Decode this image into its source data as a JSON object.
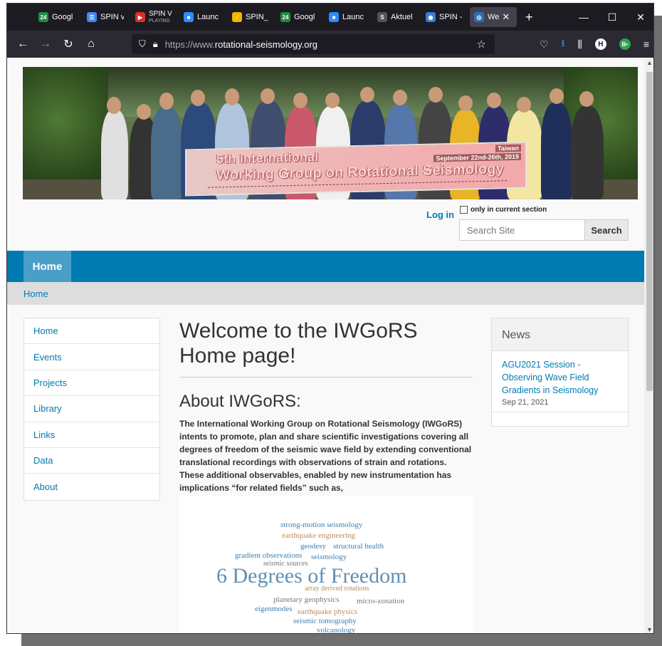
{
  "browser": {
    "tabs": [
      {
        "label": "Googl",
        "fav_color": "#1e8e3e",
        "fav_text": "24"
      },
      {
        "label": "SPIN v",
        "fav_color": "#4285f4",
        "fav_text": "☰"
      },
      {
        "label": "SPIN V",
        "sublabel": "PLAYING",
        "fav_color": "#d93025",
        "fav_text": "▶"
      },
      {
        "label": "Launc",
        "fav_color": "#2d8cff",
        "fav_text": "■"
      },
      {
        "label": "SPIN_",
        "fav_color": "#f4b400",
        "fav_text": "⚡"
      },
      {
        "label": "Googl",
        "fav_color": "#1e8e3e",
        "fav_text": "24"
      },
      {
        "label": "Launc",
        "fav_color": "#2d8cff",
        "fav_text": "■"
      },
      {
        "label": "Aktuel",
        "fav_color": "#555",
        "fav_text": "S"
      },
      {
        "label": "SPIN -",
        "fav_color": "#3a7bd5",
        "fav_text": "◉"
      },
      {
        "label": "We",
        "fav_color": "#2f6eb5",
        "fav_text": "◎",
        "active": true
      }
    ],
    "url_prefix": "https://www.",
    "url_domain": "rotational-seismology.org",
    "avatar_h": "H",
    "avatar_b": "B•"
  },
  "banner": {
    "sign_line1": "5th International",
    "sign_line2": "Working Group on Rotational Seismology",
    "sign_place": "Taiwan",
    "sign_date": "September 22nd-26th, 2019"
  },
  "header": {
    "login": "Log in",
    "only_section": "only in current section",
    "search_placeholder": "Search Site",
    "search_button": "Search"
  },
  "nav": {
    "home": "Home"
  },
  "breadcrumb": {
    "home": "Home"
  },
  "sidebar": {
    "items": [
      "Home",
      "Events",
      "Projects",
      "Library",
      "Links",
      "Data",
      "About"
    ]
  },
  "main": {
    "title": "Welcome to the IWGoRS Home page!",
    "subtitle": "About IWGoRS:",
    "body": "The International Working Group on Rotational Seismology (IWGoRS) intents to promote, plan and share scientific investigations covering all degrees of freedom of the seismic wave field by extending conventional translational recordings with observations of strain and rotations.  These additional observables, enabled by new instrumentation has implications “for related fields” such as,"
  },
  "wordcloud": [
    {
      "text": "strong-motion seismology",
      "color": "#3a7fb0"
    },
    {
      "text": "earthquake engineering",
      "color": "#c08a55"
    },
    {
      "text": "geodesy",
      "color": "#3a7fb0"
    },
    {
      "text": "structural health",
      "color": "#3a7fb0"
    },
    {
      "text": "gradient observations",
      "color": "#3a7fb0"
    },
    {
      "text": "seismology",
      "color": "#3a7fb0"
    },
    {
      "text": "seismic sources",
      "color": "#777"
    },
    {
      "text": "6 Degrees of Freedom",
      "color": "#5f8fb3"
    },
    {
      "text": "array derived rotations",
      "color": "#c08a55"
    },
    {
      "text": "planetary geophysics",
      "color": "#777"
    },
    {
      "text": "micro-zonation",
      "color": "#777"
    },
    {
      "text": "eigenmodes",
      "color": "#3a7fb0"
    },
    {
      "text": "earthquake physics",
      "color": "#c08a55"
    },
    {
      "text": "seismic tomography",
      "color": "#3a7fb0"
    },
    {
      "text": "volcanology",
      "color": "#3a7fb0"
    }
  ],
  "news": {
    "heading": "News",
    "items": [
      {
        "title": "AGU2021 Session - Observing Wave Field Gradients in Seismology",
        "date": "Sep 21, 2021"
      }
    ]
  }
}
